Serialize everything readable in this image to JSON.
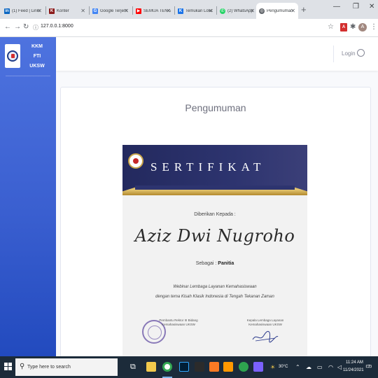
{
  "browser": {
    "tabs": [
      {
        "label": "(1) Feed | Linke",
        "favicon_color": "#0a66c2",
        "favicon_text": "in"
      },
      {
        "label": "Konter",
        "favicon_color": "#8b1a1a",
        "favicon_text": "K"
      },
      {
        "label": "Google Terjem",
        "favicon_color": "#4285f4",
        "favicon_text": "G"
      },
      {
        "label": "SEMUA TENTA",
        "favicon_color": "#ff0000",
        "favicon_text": "▶"
      },
      {
        "label": "Temukan Lowo",
        "favicon_color": "#1a73e8",
        "favicon_text": "K"
      },
      {
        "label": "(2) WhatsApp",
        "favicon_color": "#25d366",
        "favicon_text": "✆"
      },
      {
        "label": "Pengumuman",
        "favicon_color": "#5f6368",
        "favicon_text": "◎"
      }
    ],
    "active_tab_index": 6,
    "url": "127.0.0.1:8000"
  },
  "sidebar": {
    "brand_lines": [
      "KKM",
      "FTI",
      "UKSW"
    ]
  },
  "topbar": {
    "login_label": "Login"
  },
  "card": {
    "title": "Pengumuman"
  },
  "certificate": {
    "heading": "SERTIFIKAT",
    "given_to": "Diberikan Kepada :",
    "recipient": "Aziz Dwi Nugroho",
    "role_prefix": "Sebagai : ",
    "role": "Panitia",
    "event_line_1": "Webinar Lembaga Layanan Kemahasiswaan",
    "event_line_2": "dengan tema Kisah Klasik Indonesia di Tengah Tekanan Zaman",
    "signer_left_title": "Pembantu Rektor III Bidang Kemahasiswaan UKSW",
    "signer_right_title": "Kepala Lembaga Layanan Kemahasiswaan UKSW"
  },
  "taskbar": {
    "search_placeholder": "Type here to search",
    "temperature": "30°C",
    "time": "11:24 AM",
    "date": "11/24/2021",
    "notification_count": "2"
  },
  "colors": {
    "sidebar": "#4e73df",
    "certificate_header": "#2d346f",
    "gold": "#c9a54a"
  }
}
